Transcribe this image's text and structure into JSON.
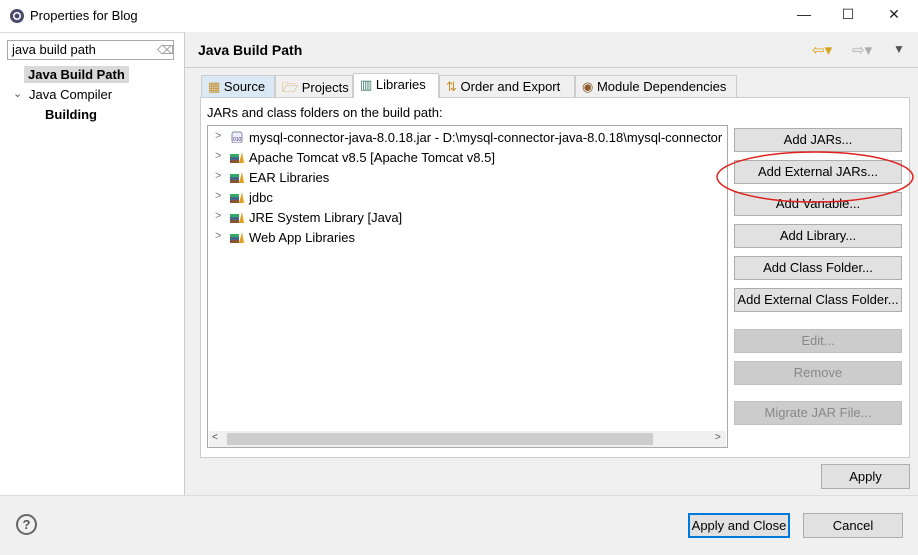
{
  "window": {
    "title": "Properties for Blog",
    "minimize": "—",
    "maximize": "☐",
    "close": "✕"
  },
  "filter": {
    "value": "java build path"
  },
  "tree": [
    {
      "label": "Java Build Path",
      "bold": true
    },
    {
      "label": "Java Compiler",
      "bold": false
    },
    {
      "label": "Building",
      "bold": true
    }
  ],
  "header": {
    "title": "Java Build Path"
  },
  "tabs": [
    {
      "label": "Source"
    },
    {
      "label": "Projects"
    },
    {
      "label": "Libraries"
    },
    {
      "label": "Order and Export"
    },
    {
      "label": "Module Dependencies"
    }
  ],
  "libraries": {
    "label": "JARs and class folders on the build path:",
    "items": [
      {
        "label": "mysql-connector-java-8.0.18.jar - D:\\mysql-connector-java-8.0.18\\mysql-connector",
        "icon": "jar-icon"
      },
      {
        "label": "Apache Tomcat v8.5 [Apache Tomcat v8.5]",
        "icon": "library-icon"
      },
      {
        "label": "EAR Libraries",
        "icon": "library-icon"
      },
      {
        "label": "jdbc",
        "icon": "library-icon"
      },
      {
        "label": "JRE System Library [Java]",
        "icon": "library-icon"
      },
      {
        "label": "Web App Libraries",
        "icon": "library-icon"
      }
    ]
  },
  "buttons": [
    {
      "label": "Add JARs...",
      "enabled": true
    },
    {
      "label": "Add External JARs...",
      "enabled": true
    },
    {
      "label": "Add Variable...",
      "enabled": true
    },
    {
      "label": "Add Library...",
      "enabled": true
    },
    {
      "label": "Add Class Folder...",
      "enabled": true
    },
    {
      "label": "Add External Class Folder...",
      "enabled": true
    },
    {
      "label": "Edit...",
      "enabled": false
    },
    {
      "label": "Remove",
      "enabled": false
    },
    {
      "label": "Migrate JAR File...",
      "enabled": false
    }
  ],
  "footer": {
    "apply": "Apply",
    "apply_close": "Apply and Close",
    "cancel": "Cancel",
    "help": "?"
  },
  "annotation_color": "#e0201c"
}
